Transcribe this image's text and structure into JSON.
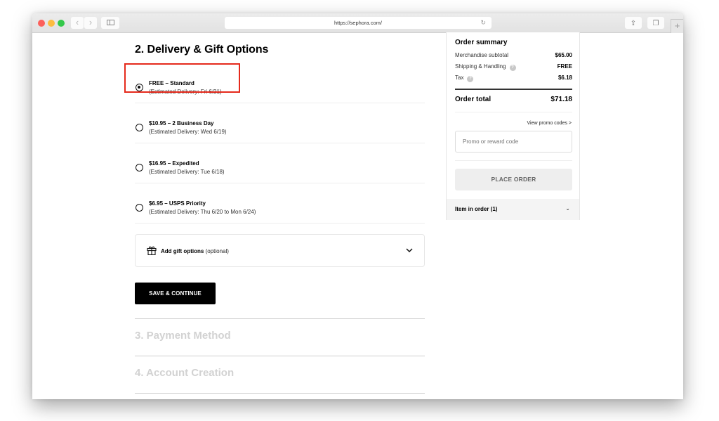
{
  "browser": {
    "url": "https://sephora.com/",
    "back_glyph": "‹",
    "forward_glyph": "›",
    "reload_glyph": "↻",
    "share_glyph": "⇪",
    "tabs_glyph": "❐",
    "new_tab_glyph": "+",
    "icons": [
      "close-window",
      "minimize-window",
      "zoom-window",
      "back-icon",
      "forward-icon",
      "sidebar-icon",
      "reload-icon",
      "share-icon",
      "tabs-icon",
      "new-tab-icon"
    ]
  },
  "delivery": {
    "title": "2. Delivery & Gift Options",
    "options": [
      {
        "title": "FREE – Standard",
        "subtitle": "(Estimated Delivery: Fri 6/21)",
        "selected": true
      },
      {
        "title": "$10.95 – 2 Business Day",
        "subtitle": "(Estimated Delivery: Wed 6/19)",
        "selected": false
      },
      {
        "title": "$16.95 – Expedited",
        "subtitle": "(Estimated Delivery: Tue 6/18)",
        "selected": false
      },
      {
        "title": "$6.95 – USPS Priority",
        "subtitle": "(Estimated Delivery: Thu 6/20 to Mon 6/24)",
        "selected": false
      }
    ],
    "highlight_color": "#e52a1c",
    "gift": {
      "label": "Add gift options",
      "optional": "(optional)"
    },
    "save_button": "SAVE & CONTINUE"
  },
  "next_steps": [
    {
      "title": "3. Payment Method"
    },
    {
      "title": "4. Account Creation"
    }
  ],
  "summary": {
    "title": "Order summary",
    "rows": [
      {
        "label": "Merchandise subtotal",
        "value": "$65.00",
        "help": false
      },
      {
        "label": "Shipping & Handling",
        "value": "FREE",
        "help": true
      },
      {
        "label": "Tax",
        "value": "$6.18",
        "help": true
      }
    ],
    "help_glyph": "?",
    "total_label": "Order total",
    "total_value": "$71.18",
    "promo_link": "View promo codes >",
    "promo_placeholder": "Promo or reward code",
    "place_order": "PLACE ORDER",
    "items_label": "Item in order (1)",
    "items_chevron": "⌄"
  }
}
